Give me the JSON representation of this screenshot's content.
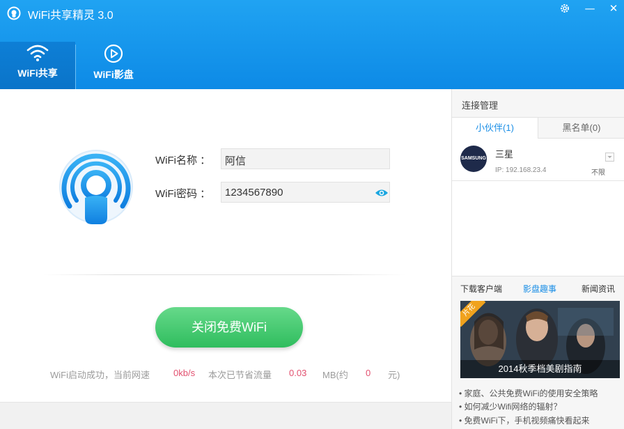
{
  "app": {
    "title": "WiFi共享精灵 3.0"
  },
  "window_controls": {
    "settings_icon": "gear-icon",
    "minimize": "—",
    "close": "✕"
  },
  "nav": {
    "tabs": [
      {
        "label": "WiFi共享",
        "icon": "wifi-icon",
        "active": true
      },
      {
        "label": "WiFi影盘",
        "icon": "play-icon",
        "active": false
      }
    ]
  },
  "wifi_form": {
    "name_label": "WiFi名称 ：",
    "name_value": "阿信",
    "password_label": "WiFi密码 ：",
    "password_value": "1234567890",
    "toggle_icon": "eye-icon"
  },
  "action": {
    "button_label": "关闭免费WiFi"
  },
  "status": {
    "prefix": "WiFi启动成功，当前网速",
    "speed": "0kb/s",
    "saved_label": "本次已节省流量",
    "saved_value": "0.03",
    "unit": "MB(约",
    "money": "0",
    "money_unit": "元)"
  },
  "sidebar": {
    "title": "连接管理",
    "tabs": [
      {
        "label": "小伙伴(1)",
        "active": true
      },
      {
        "label": "黑名单(0)",
        "active": false
      }
    ],
    "devices": [
      {
        "avatar_text": "SAMSUNG",
        "name": "三星",
        "ip": "IP: 192.168.23.4",
        "limit": "不限"
      }
    ]
  },
  "news": {
    "tabs": [
      {
        "label": "下载客户端",
        "active": false
      },
      {
        "label": "影盘趣事",
        "active": true
      },
      {
        "label": "新闻资讯",
        "active": false
      }
    ],
    "banner": {
      "tag": "片花",
      "caption": "2014秋季档美剧指南"
    },
    "items": [
      "• 家庭、公共免费WiFi的使用安全策略",
      "• 如何减少Wifi网络的辐射？",
      "• 免费WiFi下，手机视频痛快看起来"
    ]
  },
  "colors": {
    "header": "#1699ec",
    "accent": "#1a8ee6",
    "button": "#3cc46a",
    "highlight": "#e2506f"
  }
}
